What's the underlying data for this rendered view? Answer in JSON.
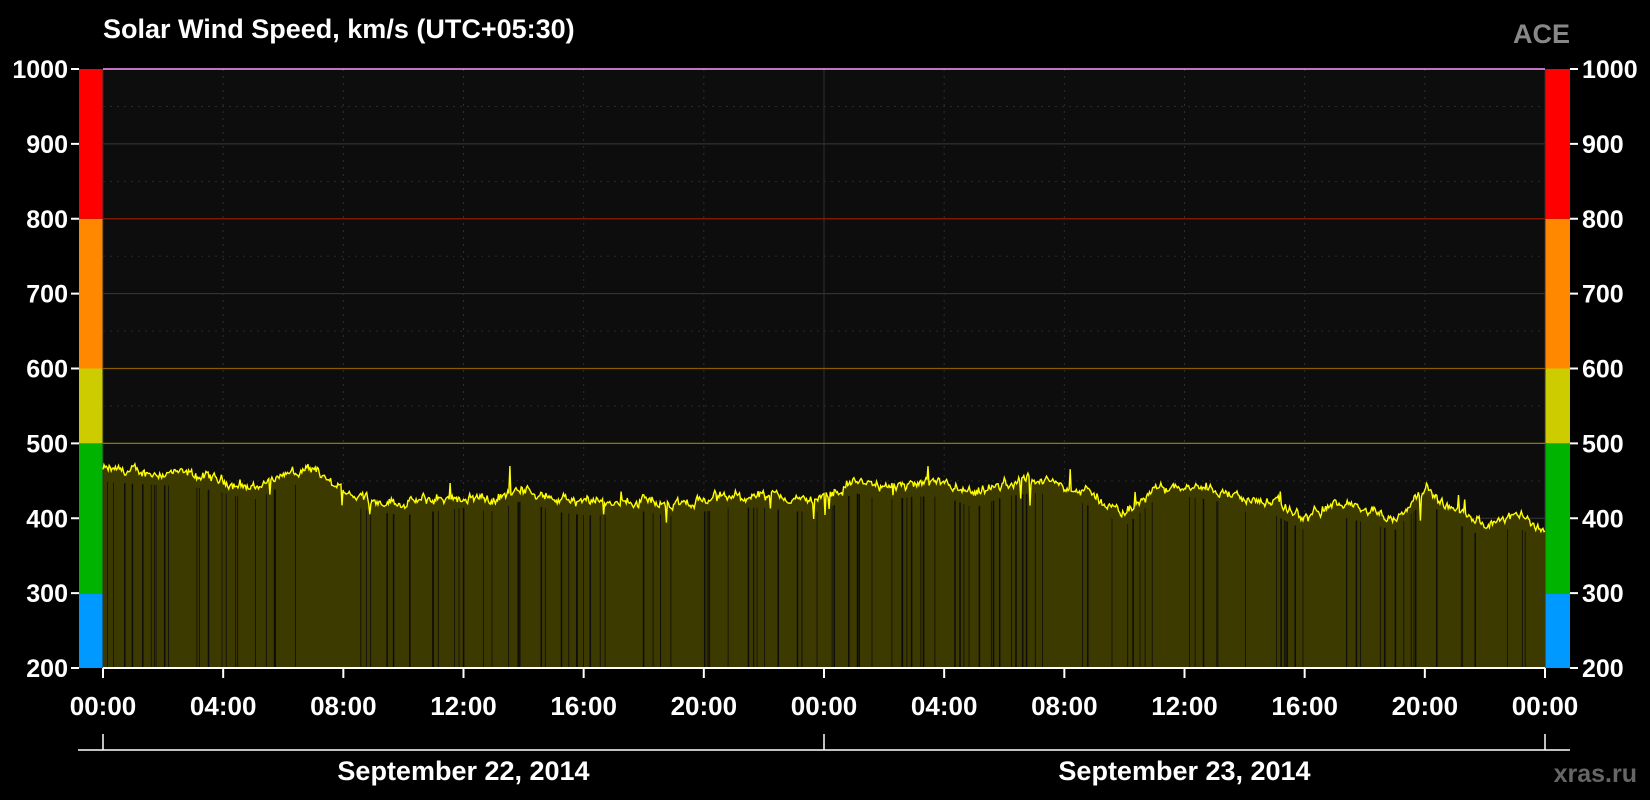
{
  "chart_data": {
    "type": "area",
    "title": "Solar Wind Speed, km/s (UTC+05:30)",
    "source_label": "ACE",
    "watermark": "xras.ru",
    "ylim": [
      200,
      1000
    ],
    "yticks": [
      200,
      300,
      400,
      500,
      600,
      700,
      800,
      900,
      1000
    ],
    "ytick_labels": [
      "200",
      "300",
      "400",
      "500",
      "600",
      "700",
      "800",
      "900",
      "1000"
    ],
    "xlim_hours": [
      0,
      48
    ],
    "xticks_hours": [
      0,
      4,
      8,
      12,
      16,
      20,
      24,
      28,
      32,
      36,
      40,
      44,
      48
    ],
    "xtick_labels": [
      "00:00",
      "04:00",
      "08:00",
      "12:00",
      "16:00",
      "20:00",
      "00:00",
      "04:00",
      "08:00",
      "12:00",
      "16:00",
      "20:00",
      "00:00"
    ],
    "date_labels": [
      {
        "label": "September 22, 2014",
        "center_hour": 12
      },
      {
        "label": "September 23, 2014",
        "center_hour": 36
      }
    ],
    "grid": true,
    "color_bands": [
      {
        "from": 200,
        "to": 300,
        "color": "#0099ff"
      },
      {
        "from": 300,
        "to": 500,
        "color": "#00b300"
      },
      {
        "from": 500,
        "to": 600,
        "color": "#cccc00"
      },
      {
        "from": 600,
        "to": 800,
        "color": "#ff8800"
      },
      {
        "from": 800,
        "to": 1000,
        "color": "#ff0000"
      }
    ],
    "threshold_lines": [
      {
        "value": 500,
        "color": "#8a7a00"
      },
      {
        "value": 600,
        "color": "#8a5a00"
      },
      {
        "value": 800,
        "color": "#8a1a00"
      }
    ],
    "series": [
      {
        "color": "#ffff00",
        "fill": "#3d3a00",
        "x_hours": [
          0,
          1,
          2,
          3,
          4,
          5,
          6,
          7,
          8,
          9,
          10,
          11,
          12,
          13,
          14,
          15,
          16,
          17,
          18,
          19,
          20,
          21,
          22,
          23,
          24,
          25,
          26,
          27,
          28,
          29,
          30,
          31,
          32,
          33,
          34,
          35,
          36,
          37,
          38,
          39,
          40,
          41,
          42,
          43,
          44,
          45,
          46,
          47,
          48
        ],
        "values": [
          465,
          462,
          460,
          458,
          450,
          440,
          460,
          462,
          435,
          425,
          420,
          425,
          430,
          425,
          440,
          425,
          420,
          420,
          425,
          418,
          425,
          430,
          430,
          425,
          425,
          450,
          440,
          445,
          445,
          430,
          445,
          450,
          445,
          430,
          405,
          440,
          445,
          440,
          425,
          420,
          400,
          420,
          410,
          400,
          440,
          410,
          390,
          405,
          385
        ]
      }
    ],
    "colors": {
      "background": "#000000",
      "plot_background": "#0d0d0d",
      "grid": "#333333",
      "axis": "#ffffff",
      "source_label": "#888888",
      "watermark": "#666666"
    }
  }
}
